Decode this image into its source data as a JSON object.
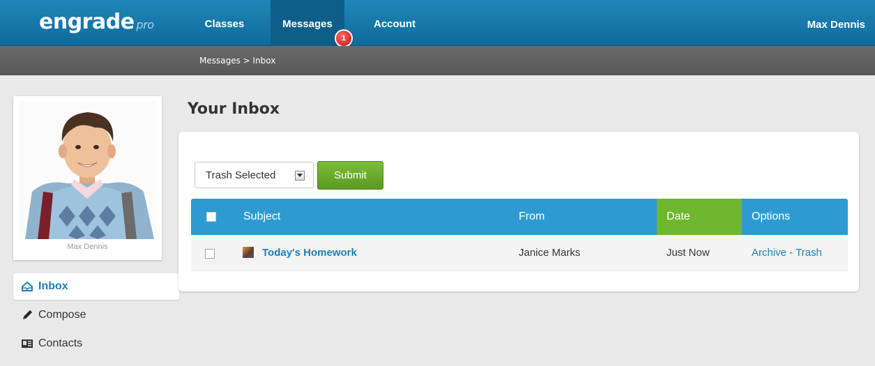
{
  "header": {
    "logo_text": "engrade",
    "logo_suffix": "pro",
    "nav": {
      "classes": "Classes",
      "messages": "Messages",
      "account": "Account"
    },
    "messages_badge": "1",
    "user_name": "Max Dennis"
  },
  "breadcrumb": "Messages > Inbox",
  "profile": {
    "name": "Max Dennis"
  },
  "sidebar": {
    "items": [
      {
        "label": "Inbox",
        "icon": "inbox-icon",
        "active": true
      },
      {
        "label": "Compose",
        "icon": "pencil-icon"
      },
      {
        "label": "Contacts",
        "icon": "contacts-icon"
      }
    ]
  },
  "main": {
    "title": "Your Inbox",
    "bulk_action": {
      "selected": "Trash Selected",
      "submit_label": "Submit"
    },
    "table": {
      "columns": [
        "Subject",
        "From",
        "Date",
        "Options"
      ],
      "rows": [
        {
          "subject": "Today's Homework",
          "from": "Janice Marks",
          "date": "Just Now",
          "archive": "Archive",
          "separator": " - ",
          "trash": "Trash"
        }
      ]
    }
  },
  "colors": {
    "nav_blue": "#1179ad",
    "breadcrumb_gray": "#606060",
    "table_header_blue": "#2d9bd2",
    "date_header_green": "#6eb72e",
    "submit_green": "#6aab2c",
    "link_blue": "#1f7fb5"
  }
}
